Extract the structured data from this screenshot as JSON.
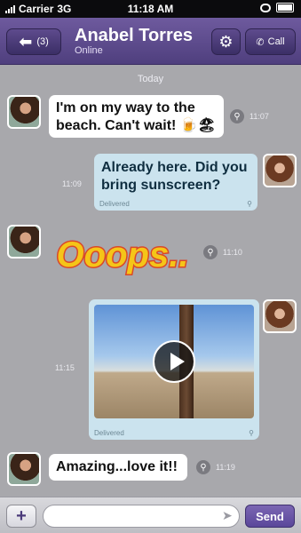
{
  "status_bar": {
    "carrier": "Carrier",
    "network": "3G",
    "time": "11:18 AM"
  },
  "header": {
    "back_count": "(3)",
    "contact_name": "Anabel Torres",
    "contact_status": "Online",
    "call_label": "Call"
  },
  "chat": {
    "day_label": "Today",
    "messages": [
      {
        "direction": "in",
        "text": "I'm on my way to the beach. Can't wait! 🍺🏖",
        "time": "11:07"
      },
      {
        "direction": "out",
        "text": "Already here. Did you bring sunscreen?",
        "time": "11:09",
        "status": "Delivered"
      },
      {
        "direction": "in",
        "type": "sticker",
        "text": "Ooops..",
        "time": "11:10"
      },
      {
        "direction": "out",
        "type": "video",
        "time": "11:15",
        "status": "Delivered"
      },
      {
        "direction": "in",
        "text": "Amazing...love it!!",
        "time": "11:19"
      }
    ]
  },
  "compose": {
    "placeholder": "",
    "send_label": "Send"
  },
  "colors": {
    "header": "#5a4890",
    "accent": "#6b57a8",
    "outgoing": "#cbe3ee",
    "incoming": "#ffffff"
  }
}
